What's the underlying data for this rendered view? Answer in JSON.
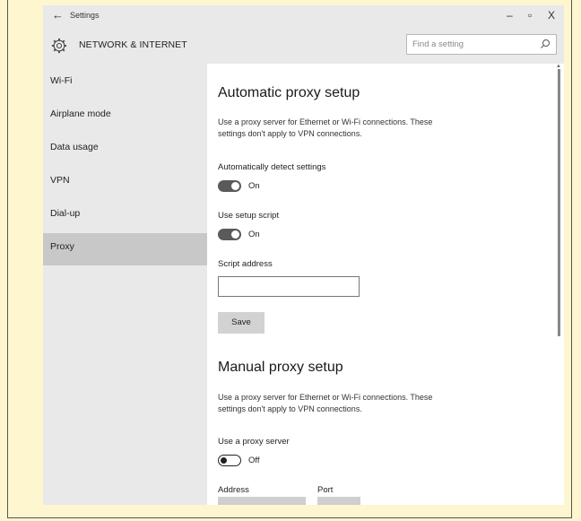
{
  "window": {
    "back_glyph": "←",
    "title": "Settings",
    "minimize_glyph": "–",
    "maximize_glyph": "▫",
    "close_glyph": "X"
  },
  "header": {
    "title": "NETWORK & INTERNET",
    "search_placeholder": "Find a setting"
  },
  "sidebar": {
    "items": [
      {
        "label": "Wi-Fi"
      },
      {
        "label": "Airplane mode"
      },
      {
        "label": "Data usage"
      },
      {
        "label": "VPN"
      },
      {
        "label": "Dial-up"
      },
      {
        "label": "Proxy",
        "active": true
      }
    ]
  },
  "automatic": {
    "title": "Automatic proxy setup",
    "description": "Use a proxy server for Ethernet or Wi-Fi connections. These settings don't apply to VPN connections.",
    "auto_detect_label": "Automatically detect settings",
    "auto_detect_state": "On",
    "setup_script_label": "Use setup script",
    "setup_script_state": "On",
    "script_address_label": "Script address",
    "script_address_value": "",
    "save_label": "Save"
  },
  "manual": {
    "title": "Manual proxy setup",
    "description": "Use a proxy server for Ethernet or Wi-Fi connections. These settings don't apply to VPN connections.",
    "use_proxy_label": "Use a proxy server",
    "use_proxy_state": "Off",
    "address_label": "Address",
    "port_label": "Port"
  },
  "colors": {
    "page_background": "#fdf6cf",
    "chrome_gray": "#e9e9e9",
    "active_nav": "#c8c8c8",
    "toggle_on": "#5a5a5a"
  }
}
